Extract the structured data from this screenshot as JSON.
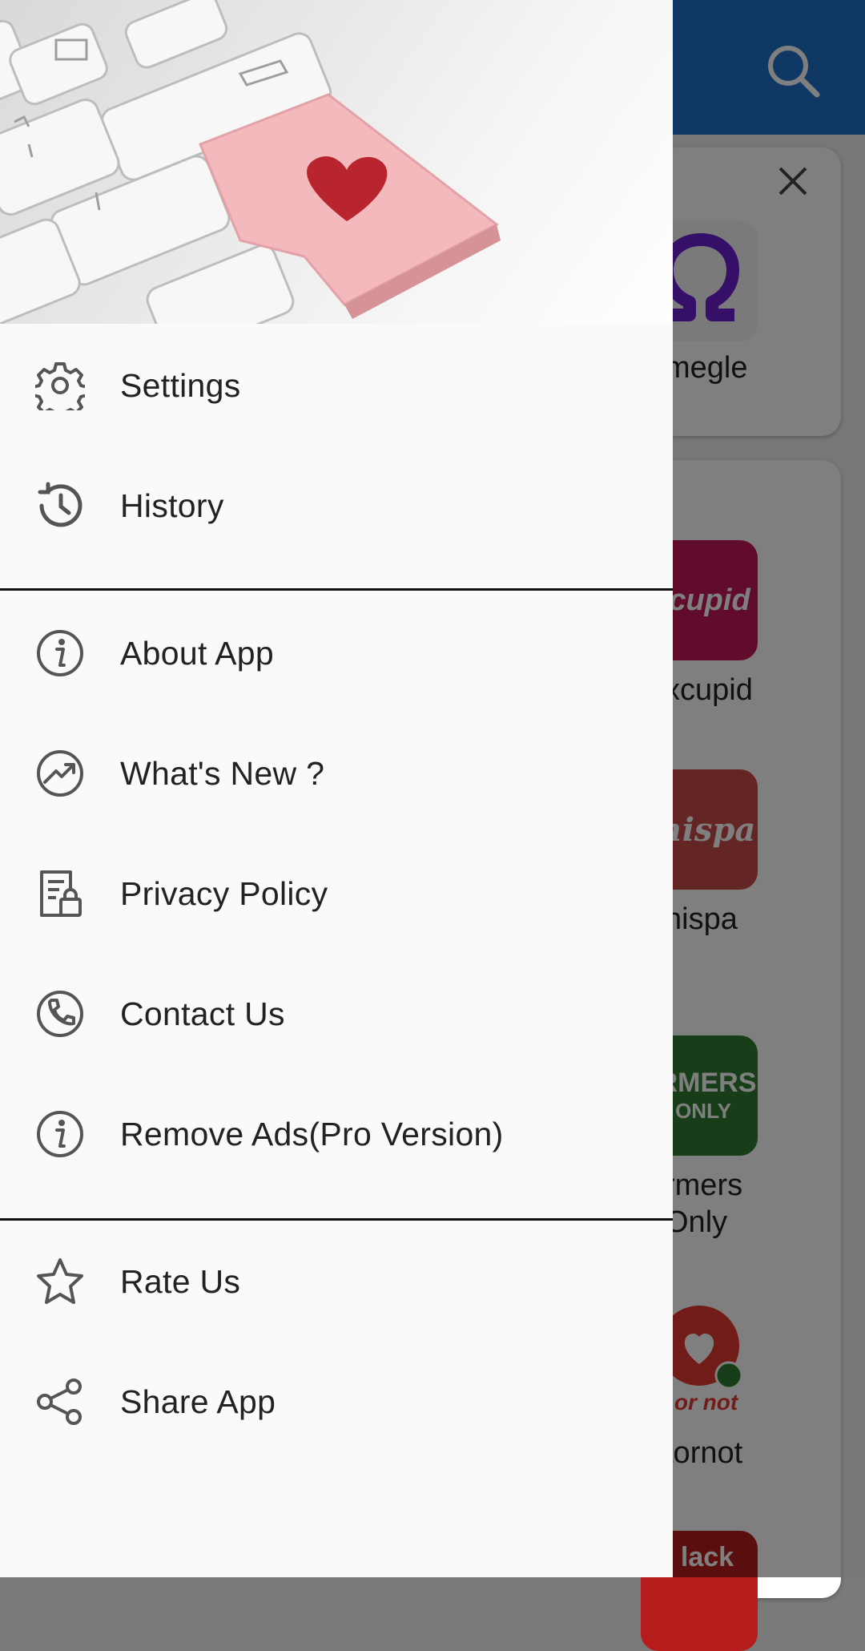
{
  "background_app": {
    "cards": [
      {
        "name": "megle",
        "color": "#ffffff"
      },
      {
        "name": "xcupid",
        "color": "#c2185b"
      },
      {
        "name": "hispa",
        "color": "#c84a4a"
      },
      {
        "name": "rmers\nOnly",
        "color": "#2e7d32"
      },
      {
        "name": "tornot",
        "color": "#ffffff"
      },
      {
        "name": "",
        "color": "#b71c1c"
      }
    ],
    "icon_texts": {
      "okcupid": "cupid",
      "whispa": "hispa",
      "farmers_line1": "RMERS",
      "farmers_line2": "ONLY",
      "hotornot": "t or not",
      "black": "lack"
    }
  },
  "drawer": {
    "menu_items": [
      {
        "label": "Settings",
        "icon": "gear-icon"
      },
      {
        "label": "History",
        "icon": "history-icon"
      },
      {
        "label": "About App",
        "icon": "info-icon"
      },
      {
        "label": "What's New ?",
        "icon": "trending-icon"
      },
      {
        "label": "Privacy Policy",
        "icon": "privacy-document-icon"
      },
      {
        "label": "Contact Us",
        "icon": "phone-icon"
      },
      {
        "label": "Remove Ads(Pro Version)",
        "icon": "info-icon"
      },
      {
        "label": "Rate Us",
        "icon": "star-icon"
      },
      {
        "label": "Share App",
        "icon": "share-icon"
      }
    ]
  },
  "colors": {
    "appbar": "#1e73c8",
    "drawer_bg": "#fafafa",
    "text": "#222222",
    "icon_stroke": "#555555"
  }
}
